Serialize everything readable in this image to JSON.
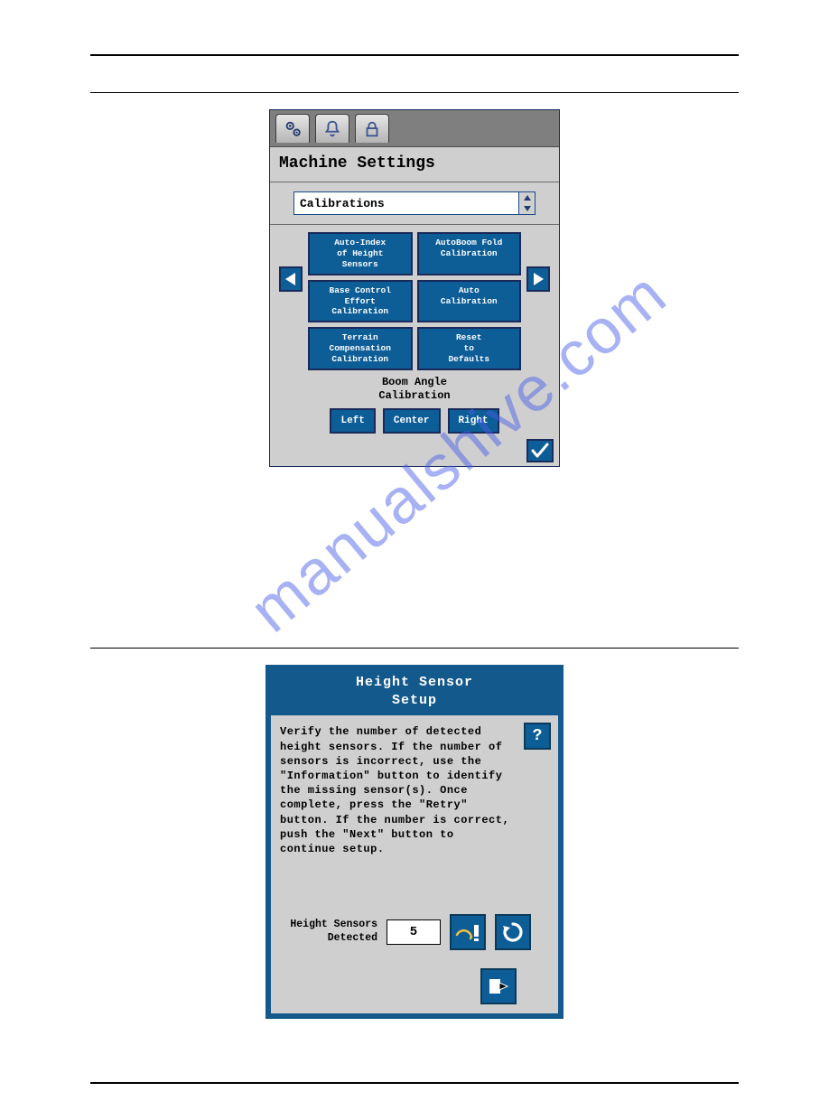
{
  "watermark": "manualshive.com",
  "window1": {
    "title": "Machine Settings",
    "dropdown": "Calibrations",
    "buttons": [
      "Auto-Index\nof Height\nSensors",
      "AutoBoom Fold\nCalibration",
      "Base Control\nEffort\nCalibration",
      "Auto\nCalibration",
      "Terrain\nCompensation\nCalibration",
      "Reset\nto\nDefaults"
    ],
    "boom_label": "Boom Angle\nCalibration",
    "lcr": [
      "Left",
      "Center",
      "Right"
    ]
  },
  "window2": {
    "title": "Height Sensor\nSetup",
    "help": "?",
    "body_text": "Verify the number of detected height sensors. If the number of sensors is incorrect, use the \"Information\" button to identify the missing sensor(s). Once complete, press the \"Retry\" button. If the number is correct, push the \"Next\" button to continue setup.",
    "detect_label": "Height Sensors\nDetected",
    "detect_value": "5"
  }
}
